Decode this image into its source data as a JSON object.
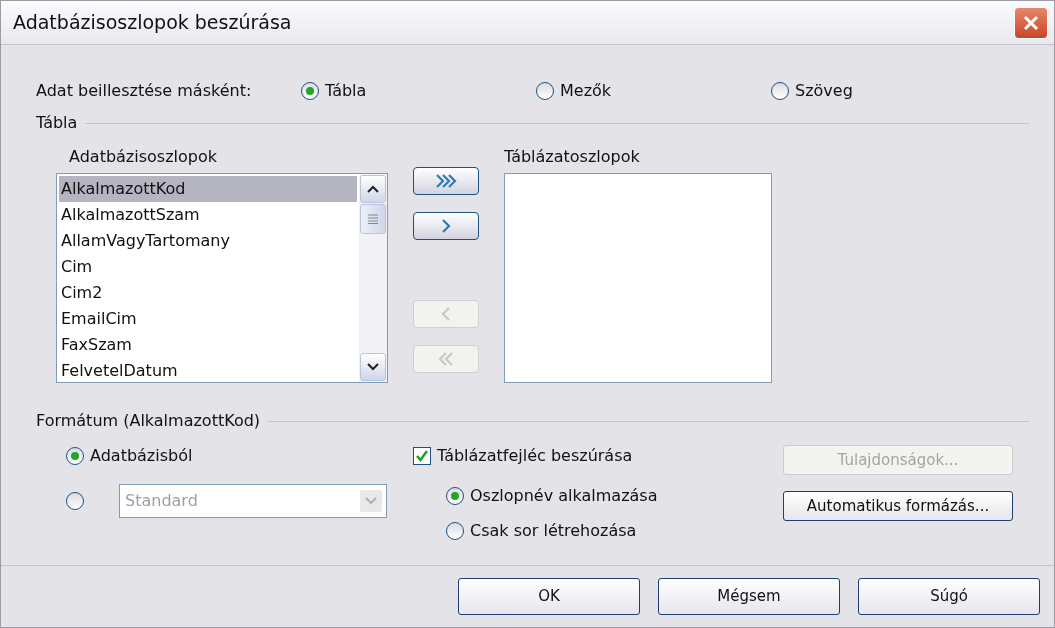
{
  "window": {
    "title": "Adatbázisoszlopok beszúrása"
  },
  "insert_as": {
    "label": "Adat beillesztése másként:",
    "options": [
      {
        "label": "Tábla",
        "selected": true
      },
      {
        "label": "Mezők",
        "selected": false
      },
      {
        "label": "Szöveg",
        "selected": false
      }
    ]
  },
  "table_section": {
    "title": "Tábla",
    "source": {
      "label": "Adatbázisoszlopok",
      "items": [
        {
          "label": "AlkalmazottKod",
          "selected": true
        },
        {
          "label": "AlkalmazottSzam",
          "selected": false
        },
        {
          "label": "AllamVagyTartomany",
          "selected": false
        },
        {
          "label": "Cim",
          "selected": false
        },
        {
          "label": "Cim2",
          "selected": false
        },
        {
          "label": "EmailCim",
          "selected": false
        },
        {
          "label": "FaxSzam",
          "selected": false
        },
        {
          "label": "FelvetelDatum",
          "selected": false
        }
      ]
    },
    "move_buttons": [
      {
        "kind": "all_right",
        "disabled": false
      },
      {
        "kind": "right",
        "disabled": false
      },
      {
        "kind": "left",
        "disabled": true
      },
      {
        "kind": "all_left",
        "disabled": true
      }
    ],
    "target": {
      "label": "Táblázatoszlopok"
    }
  },
  "format_section": {
    "title": "Formátum (AlkalmazottKod)",
    "source_options": [
      {
        "kind": "label",
        "label": "Adatbázisból",
        "selected": true
      },
      {
        "kind": "select",
        "selected": false,
        "value": "Standard",
        "disabled": true
      }
    ],
    "header_checkbox": {
      "label": "Táblázatfejléc beszúrása",
      "checked": true
    },
    "header_options": [
      {
        "label": "Oszlopnév alkalmazása",
        "selected": true
      },
      {
        "label": "Csak sor létrehozása",
        "selected": false
      }
    ],
    "buttons": [
      {
        "label": "Tulajdonságok...",
        "disabled": true
      },
      {
        "label": "Automatikus formázás...",
        "disabled": false
      }
    ]
  },
  "footer_buttons": [
    {
      "label": "OK"
    },
    {
      "label": "Mégsem"
    },
    {
      "label": "Súgó"
    }
  ]
}
